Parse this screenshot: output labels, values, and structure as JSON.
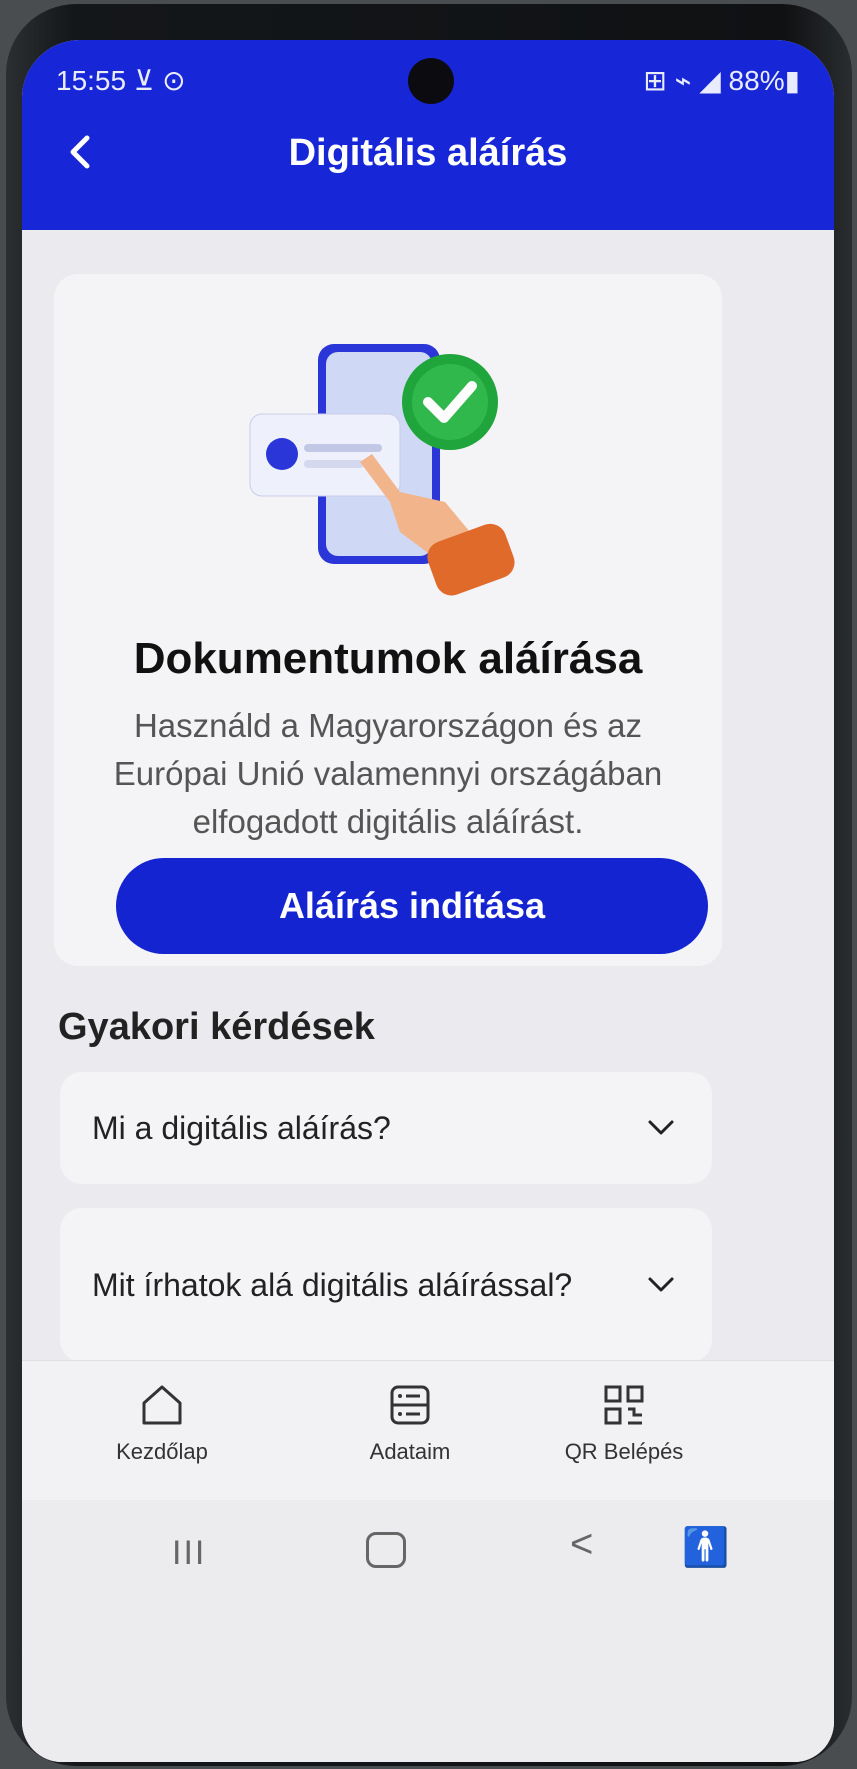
{
  "status_bar": {
    "time": "15:55 ⊻ ⊙",
    "right": "⊞ ⌁ ◢ 88%▮"
  },
  "app_bar": {
    "back_icon": "chevron-left-icon",
    "title": "Digitális aláírás"
  },
  "hero": {
    "illustration": "phone-with-signature-checkmark",
    "title": "Dokumentumok aláírása",
    "description": "Használd a Magyarországon és az Európai Unió valamennyi országában elfogadott digitális aláírást.",
    "button_label": "Aláírás indítása"
  },
  "faq": {
    "heading": "Gyakori kérdések",
    "items": [
      {
        "question": "Mi a digitális aláírás?"
      },
      {
        "question": "Mit írhatok alá digitális aláírással?"
      }
    ]
  },
  "bottom_nav": {
    "items": [
      {
        "label": "Kezdőlap",
        "icon": "home-icon"
      },
      {
        "label": "Adataim",
        "icon": "data-icon"
      },
      {
        "label": "QR Belépés",
        "icon": "qr-icon"
      }
    ]
  },
  "system_nav": {
    "recent": "III",
    "back": "<",
    "accessibility": "🚹"
  },
  "colors": {
    "primary": "#1726d6",
    "background": "#ebeaee",
    "card": "#f4f3f5"
  }
}
